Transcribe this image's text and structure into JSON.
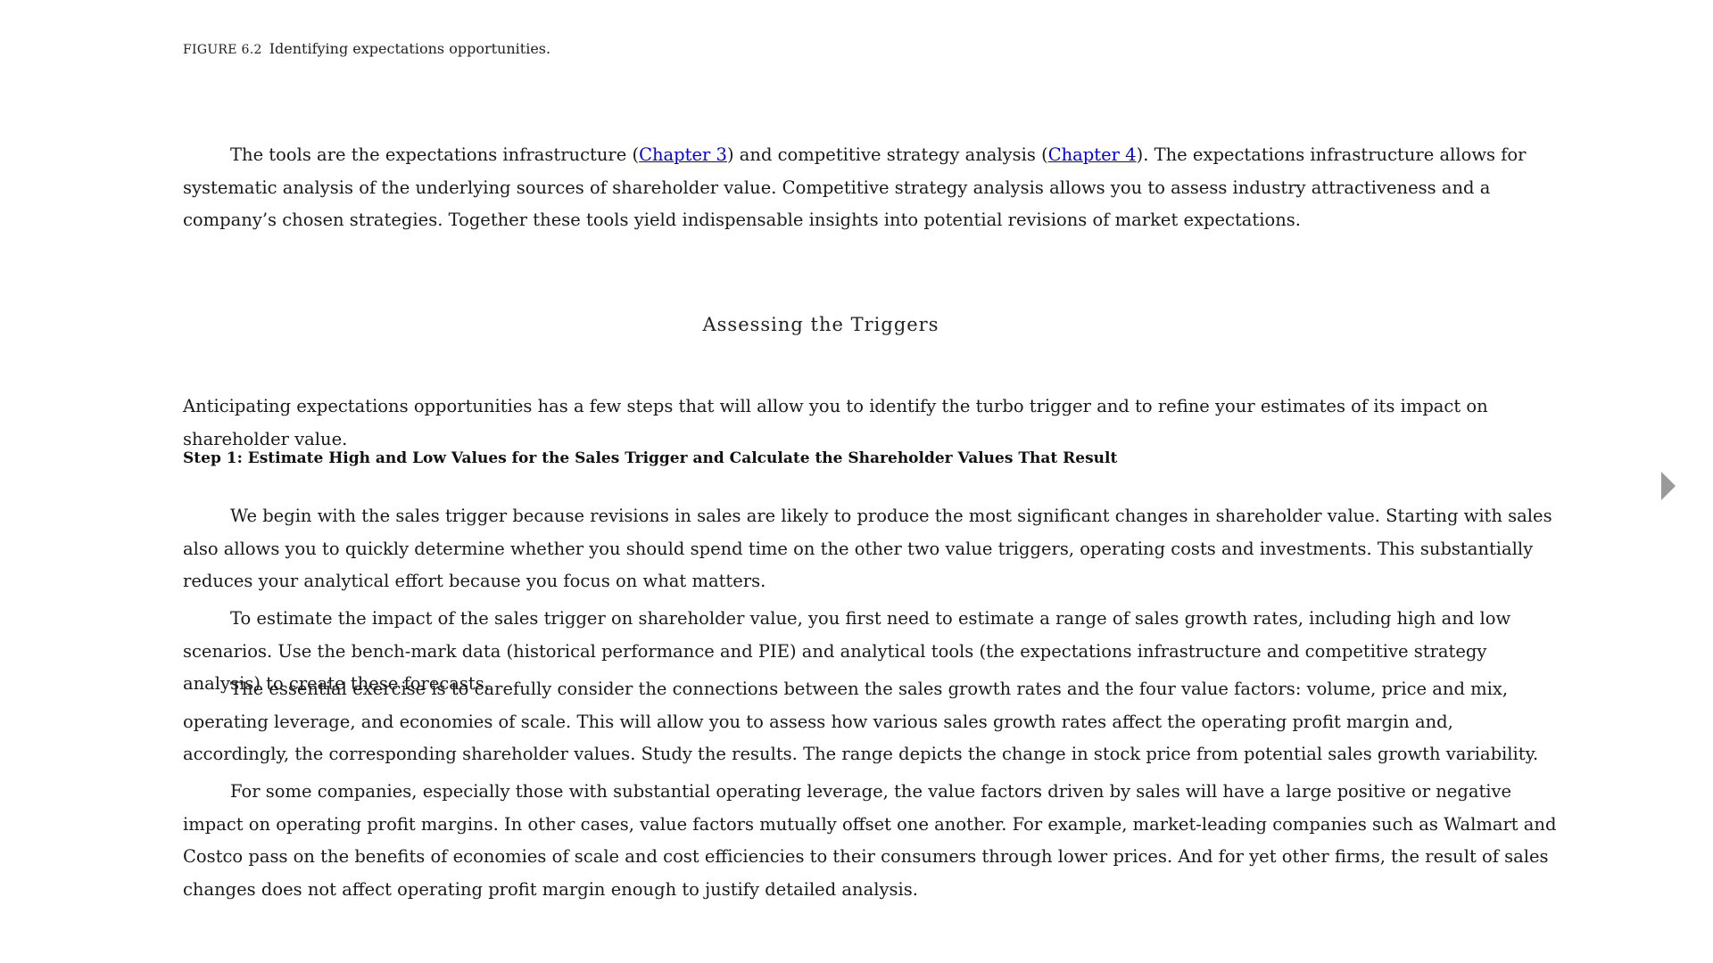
{
  "figure_caption": {
    "label": "FIGURE 6.2",
    "text": "Identifying expectations opportunities."
  },
  "intro_paragraph": {
    "part1": "The tools are the expectations infrastructure (",
    "link1": "Chapter 3",
    "part2": ") and competitive strategy analysis (",
    "link2": "Chapter 4",
    "part3": "). The expectations infrastructure allows for systematic analysis of the underlying sources of shareholder value. Competitive strategy analysis allows you to assess industry attractiveness and a company’s chosen strategies. Together these tools yield indispensable insights into potential revisions of market expectations."
  },
  "section_heading": "Assessing the Triggers",
  "section_intro": "Anticipating expectations opportunities has a few steps that will allow you to identify the turbo trigger and to refine your estimates of its impact on shareholder value.",
  "step1_heading": "Step 1: Estimate High and Low Values for the Sales Trigger and Calculate the Shareholder Values That Result",
  "paragraphs": [
    "We begin with the sales trigger because revisions in sales are likely to produce the most significant changes in shareholder value. Starting with sales also allows you to quickly determine whether you should spend time on the other two value triggers, operating costs and investments. This substantially reduces your analytical effort because you focus on what matters.",
    "To estimate the impact of the sales trigger on shareholder value, you first need to estimate a range of sales growth rates, including high and low scenarios. Use the bench-mark data (historical performance and PIE) and analytical tools (the expectations infrastructure and competitive strategy analysis) to create these forecasts.",
    "The essential exercise is to carefully consider the connections between the sales growth rates and the four value factors: volume, price and mix, operating leverage, and economies of scale. This will allow you to assess how various sales growth rates affect the operating profit margin and, accordingly, the corresponding shareholder values. Study the results. The range depicts the change in stock price from potential sales growth variability.",
    "For some companies, especially those with substantial operating leverage, the value factors driven by sales will have a large positive or negative impact on operating profit margins. In other cases, value factors mutually offset one another. For example, market-leading companies such as Walmart and Costco pass on the benefits of economies of scale and cost efficiencies to their consumers through lower prices. And for yet other firms, the result of sales changes does not affect operating profit margin enough to justify detailed analysis."
  ],
  "navigation": {
    "next_icon": "chevron-right-icon",
    "arrow_color": "#9a9a9a"
  },
  "colors": {
    "link": "#0000ee",
    "text": "#1a1a1a"
  }
}
